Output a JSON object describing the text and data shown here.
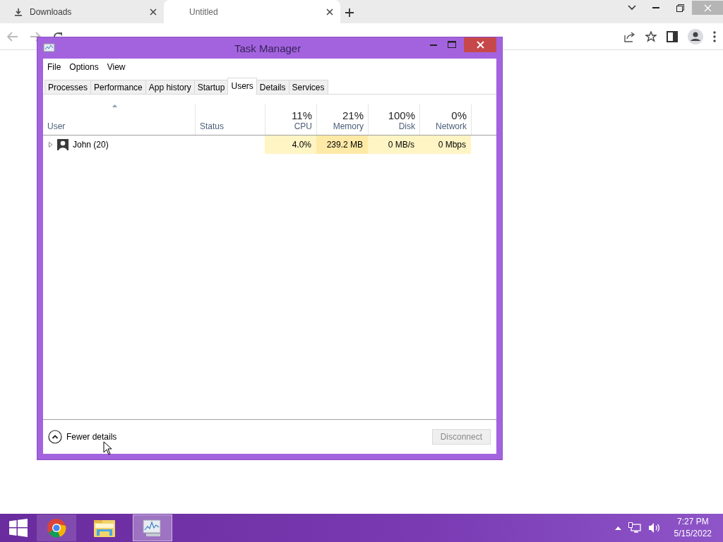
{
  "browser": {
    "tabs": [
      {
        "label": "Downloads",
        "selected": false
      },
      {
        "label": "Untitled",
        "selected": true
      }
    ]
  },
  "task_manager": {
    "title": "Task Manager",
    "menu": [
      "File",
      "Options",
      "View"
    ],
    "tabs": [
      {
        "label": "Processes",
        "selected": false
      },
      {
        "label": "Performance",
        "selected": false
      },
      {
        "label": "App history",
        "selected": false
      },
      {
        "label": "Startup",
        "selected": false
      },
      {
        "label": "Users",
        "selected": true
      },
      {
        "label": "Details",
        "selected": false
      },
      {
        "label": "Services",
        "selected": false
      }
    ],
    "columns": [
      {
        "label": "User",
        "sorted": true
      },
      {
        "label": "Status",
        "sorted": false
      },
      {
        "percent": "11%",
        "label": "CPU",
        "sorted": false
      },
      {
        "percent": "21%",
        "label": "Memory",
        "sorted": false
      },
      {
        "percent": "100%",
        "label": "Disk",
        "sorted": false
      },
      {
        "percent": "0%",
        "label": "Network",
        "sorted": false
      }
    ],
    "rows": [
      {
        "expanded": false,
        "cells": [
          {
            "text": "John (20)"
          },
          {
            "text": ""
          },
          {
            "text": "4.0%",
            "color": "#fff4c4"
          },
          {
            "text": "239.2 MB",
            "color": "#ffe9a6"
          },
          {
            "text": "0 MB/s",
            "color": "#fff4c4"
          },
          {
            "text": "0 Mbps",
            "color": "#fff4c4"
          }
        ]
      }
    ],
    "fewer_details": "Fewer details",
    "disconnect": {
      "label": "Disconnect",
      "disabled": true
    }
  },
  "taskbar": {
    "apps": [
      {
        "kind": "chrome",
        "running": true,
        "selected": false
      },
      {
        "kind": "explorer",
        "running": false,
        "selected": false
      },
      {
        "kind": "taskmgr",
        "running": true,
        "selected": true
      }
    ],
    "time": "7:27 PM",
    "date": "5/15/2022"
  }
}
